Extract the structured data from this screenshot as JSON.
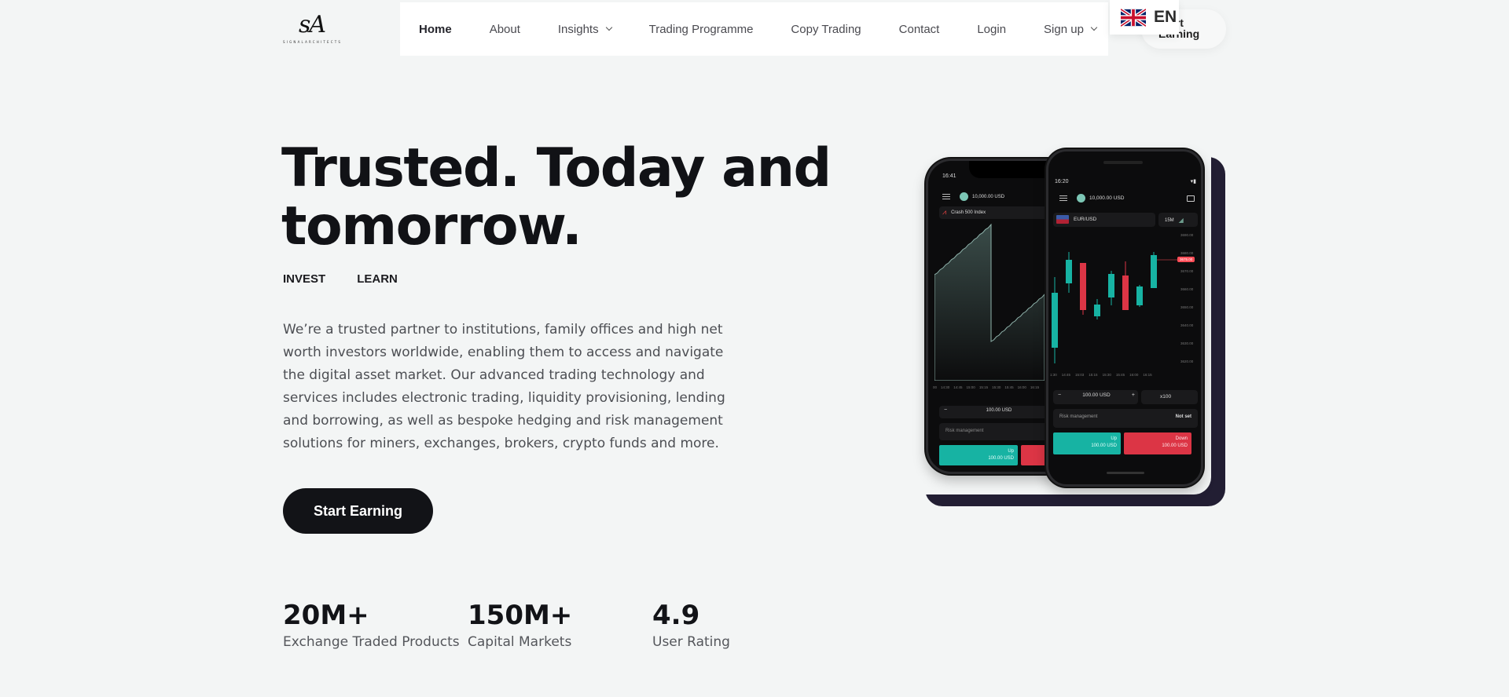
{
  "brand": {
    "logo_mark": "sA",
    "logo_tagline": "SIGNALARCHITECTS"
  },
  "nav": {
    "items": [
      {
        "label": "Home",
        "active": true,
        "has_dropdown": false
      },
      {
        "label": "About",
        "active": false,
        "has_dropdown": false
      },
      {
        "label": "Insights",
        "active": false,
        "has_dropdown": true
      },
      {
        "label": "Trading Programme",
        "active": false,
        "has_dropdown": false
      },
      {
        "label": "Copy Trading",
        "active": false,
        "has_dropdown": false
      },
      {
        "label": "Contact",
        "active": false,
        "has_dropdown": false
      },
      {
        "label": "Login",
        "active": false,
        "has_dropdown": false
      },
      {
        "label": "Sign up",
        "active": false,
        "has_dropdown": true
      }
    ],
    "start_pill_label": "Start Earning",
    "language": {
      "code": "EN",
      "flag_icon": "uk-flag-icon"
    }
  },
  "hero": {
    "title": "Trusted. Today and tomorrow.",
    "links": [
      "INVEST",
      "LEARN"
    ],
    "description": "We’re a trusted partner to institutions, family offices and high net worth investors worldwide, enabling them to access and navigate the digital asset market. Our advanced trading technology and services includes electronic trading, liquidity provisioning, lending and borrowing, as well as bespoke hedging and risk management solutions for miners, exchanges, brokers, crypto funds and more.",
    "cta_label": "Start Earning"
  },
  "stats": [
    {
      "value": "20M+",
      "label": "Exchange Traded Products"
    },
    {
      "value": "150M+",
      "label": "Capital Markets"
    },
    {
      "value": "4.9",
      "label": "User Rating"
    }
  ],
  "mockup": {
    "phone_left": {
      "time": "16:41",
      "balance": "10,000.00 USD",
      "instrument": "Crash 500 Index",
      "x_ticks": [
        "00",
        "14:30",
        "14:45",
        "15:00",
        "15:15",
        "15:30",
        "15:45",
        "16:00",
        "16:15"
      ],
      "stake": "100.00 USD",
      "risk_label": "Risk management",
      "up_label": "Up",
      "up_amount": "100.00 USD"
    },
    "phone_right": {
      "time": "16:20",
      "balance": "10,000.00 USD",
      "instrument": "EUR/USD",
      "timeframe": "15M",
      "y_ticks": [
        "3690.00",
        "3680.00",
        "3670.00",
        "3660.00",
        "3650.00",
        "3640.00",
        "3630.00",
        "3620.00"
      ],
      "price_tag": "3675.00",
      "x_ticks": [
        "1:30",
        "14:45",
        "15:03",
        "15:15",
        "15:30",
        "15:45",
        "16:00",
        "16:15"
      ],
      "stake": "100.00 USD",
      "multiplier": "x100",
      "risk_label": "Risk management",
      "risk_value": "Not set",
      "up_label": "Up",
      "up_amount": "100.00 USD",
      "down_label": "Down",
      "down_amount": "100.00 USD"
    },
    "colors": {
      "up": "#17b3a3",
      "down": "#dc3545",
      "backdrop": "#221e33"
    }
  }
}
